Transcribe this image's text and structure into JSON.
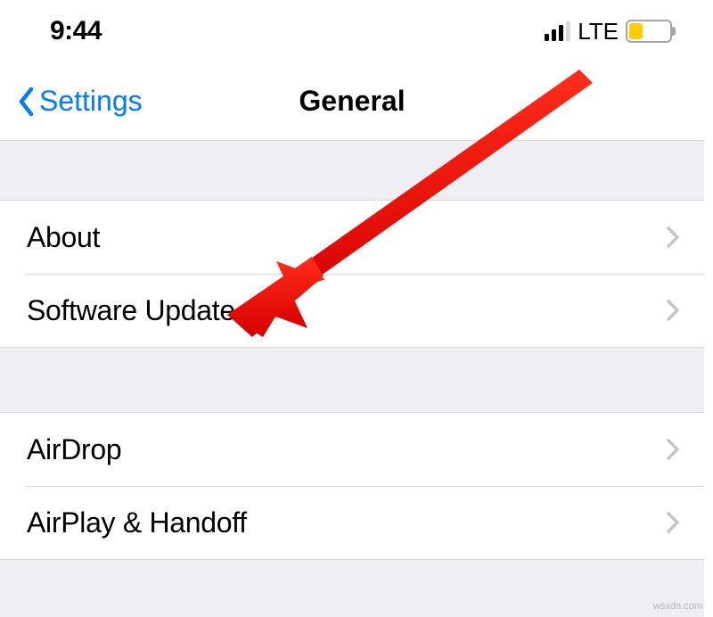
{
  "status": {
    "time": "9:44",
    "network_label": "LTE"
  },
  "nav": {
    "back_label": "Settings",
    "title": "General"
  },
  "groups": [
    {
      "rows": [
        {
          "label": "About"
        },
        {
          "label": "Software Update"
        }
      ]
    },
    {
      "rows": [
        {
          "label": "AirDrop"
        },
        {
          "label": "AirPlay & Handoff"
        }
      ]
    }
  ],
  "watermark": "wsxdn.com"
}
